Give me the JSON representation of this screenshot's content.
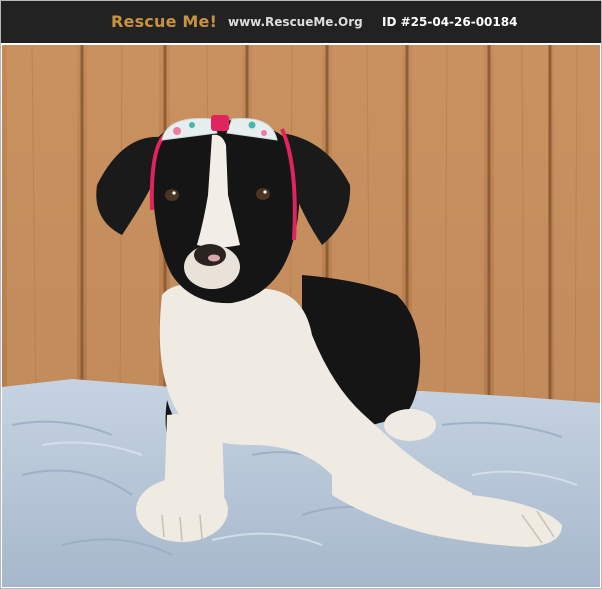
{
  "header": {
    "brand": "Rescue Me!",
    "site": "www.RescueMe.Org",
    "pet_id": "ID #25-04-26-00184"
  },
  "photo": {
    "subject": "dog-photo",
    "colors": {
      "header_bg": "#222222",
      "brand": "#c8923f",
      "fence": "#c98f5e",
      "blanket": "#b4c4d6",
      "fur_black": "#141414",
      "fur_white": "#efeae2",
      "headband": "#e0245e"
    }
  }
}
